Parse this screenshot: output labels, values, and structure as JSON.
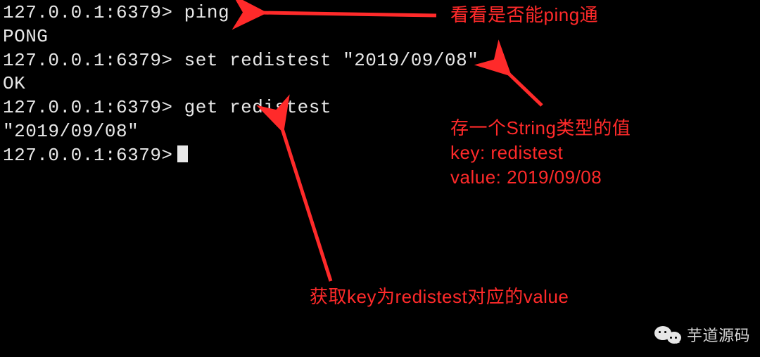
{
  "terminal": {
    "prompt": "127.0.0.1:6379>",
    "lines": [
      {
        "prompt": "127.0.0.1:6379>",
        "cmd": "ping"
      },
      {
        "out": "PONG"
      },
      {
        "prompt": "127.0.0.1:6379>",
        "cmd": "set redistest \"2019/09/08\""
      },
      {
        "out": "OK"
      },
      {
        "prompt": "127.0.0.1:6379>",
        "cmd": "get redistest"
      },
      {
        "out": "\"2019/09/08\""
      },
      {
        "prompt": "127.0.0.1:6379>",
        "cursor": true
      }
    ]
  },
  "annotations": {
    "ping_check": "看看是否能ping通",
    "store_string": "存一个String类型的值\nkey: redistest\nvalue: 2019/09/08",
    "get_value": "获取key为redistest对应的value"
  },
  "watermark": {
    "icon": "wechat-icon",
    "brand": "芋道源码"
  },
  "colors": {
    "annotation": "#ff2a2a",
    "terminal_fg": "#e8e8e8",
    "bg": "#000000"
  }
}
